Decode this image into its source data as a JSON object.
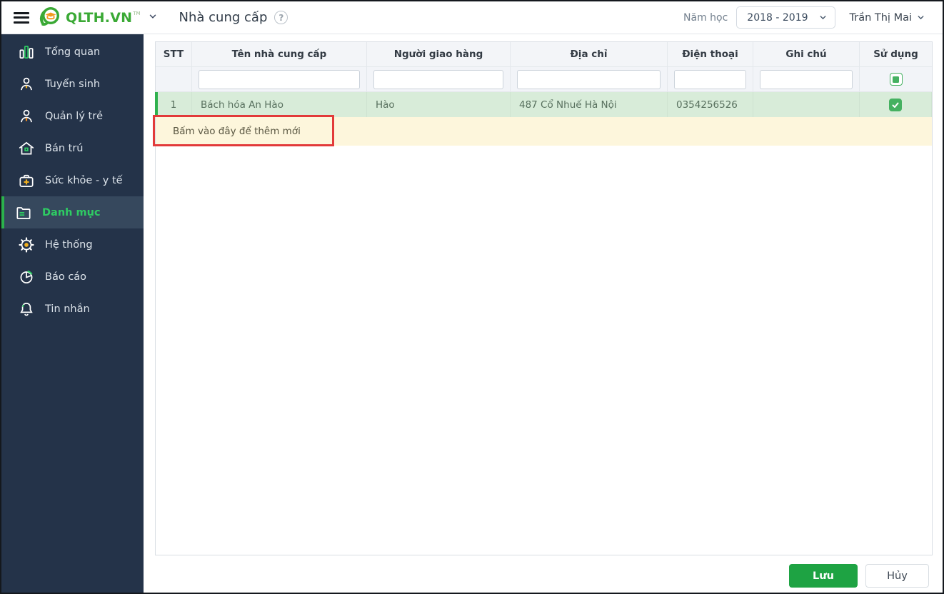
{
  "topbar": {
    "brand_name": "QLTH.VN",
    "brand_tm": "TM",
    "page_title": "Nhà cung cấp",
    "help_glyph": "?",
    "school_year_label": "Năm học",
    "school_year_value": "2018 - 2019",
    "user_name": "Trần Thị Mai"
  },
  "sidebar": {
    "items": [
      {
        "label": "Tổng quan",
        "icon": "bar-chart-icon"
      },
      {
        "label": "Tuyển sinh",
        "icon": "student-icon"
      },
      {
        "label": "Quản lý trẻ",
        "icon": "child-manage-icon"
      },
      {
        "label": "Bán trú",
        "icon": "house-icon"
      },
      {
        "label": "Sức khỏe - y tế",
        "icon": "medical-bag-icon"
      },
      {
        "label": "Danh mục",
        "icon": "folder-icon",
        "active": true
      },
      {
        "label": "Hệ thống",
        "icon": "gear-icon"
      },
      {
        "label": "Báo cáo",
        "icon": "pie-chart-icon"
      },
      {
        "label": "Tin nhắn",
        "icon": "bell-icon"
      }
    ]
  },
  "table": {
    "columns": [
      "STT",
      "Tên nhà cung cấp",
      "Người giao hàng",
      "Địa chỉ",
      "Điện thoại",
      "Ghi chú",
      "Sử dụng"
    ],
    "rows": [
      {
        "stt": "1",
        "name": "Bách hóa An Hào",
        "deliverer": "Hào",
        "address": "487 Cổ Nhuế Hà Nội",
        "phone": "0354256526",
        "note": "",
        "in_use": true
      }
    ],
    "add_row_label": "Bấm vào đây để thêm mới"
  },
  "footer": {
    "save_label": "Lưu",
    "cancel_label": "Hủy"
  },
  "colors": {
    "accent_green": "#2bb24c",
    "row_green_bg": "#d8ecd9",
    "add_row_bg": "#fdf6dc",
    "annotation_red": "#e23a3a",
    "sidebar_bg": "#243349",
    "sidebar_active_bg": "#36485d",
    "save_button_green": "#1ea343"
  }
}
